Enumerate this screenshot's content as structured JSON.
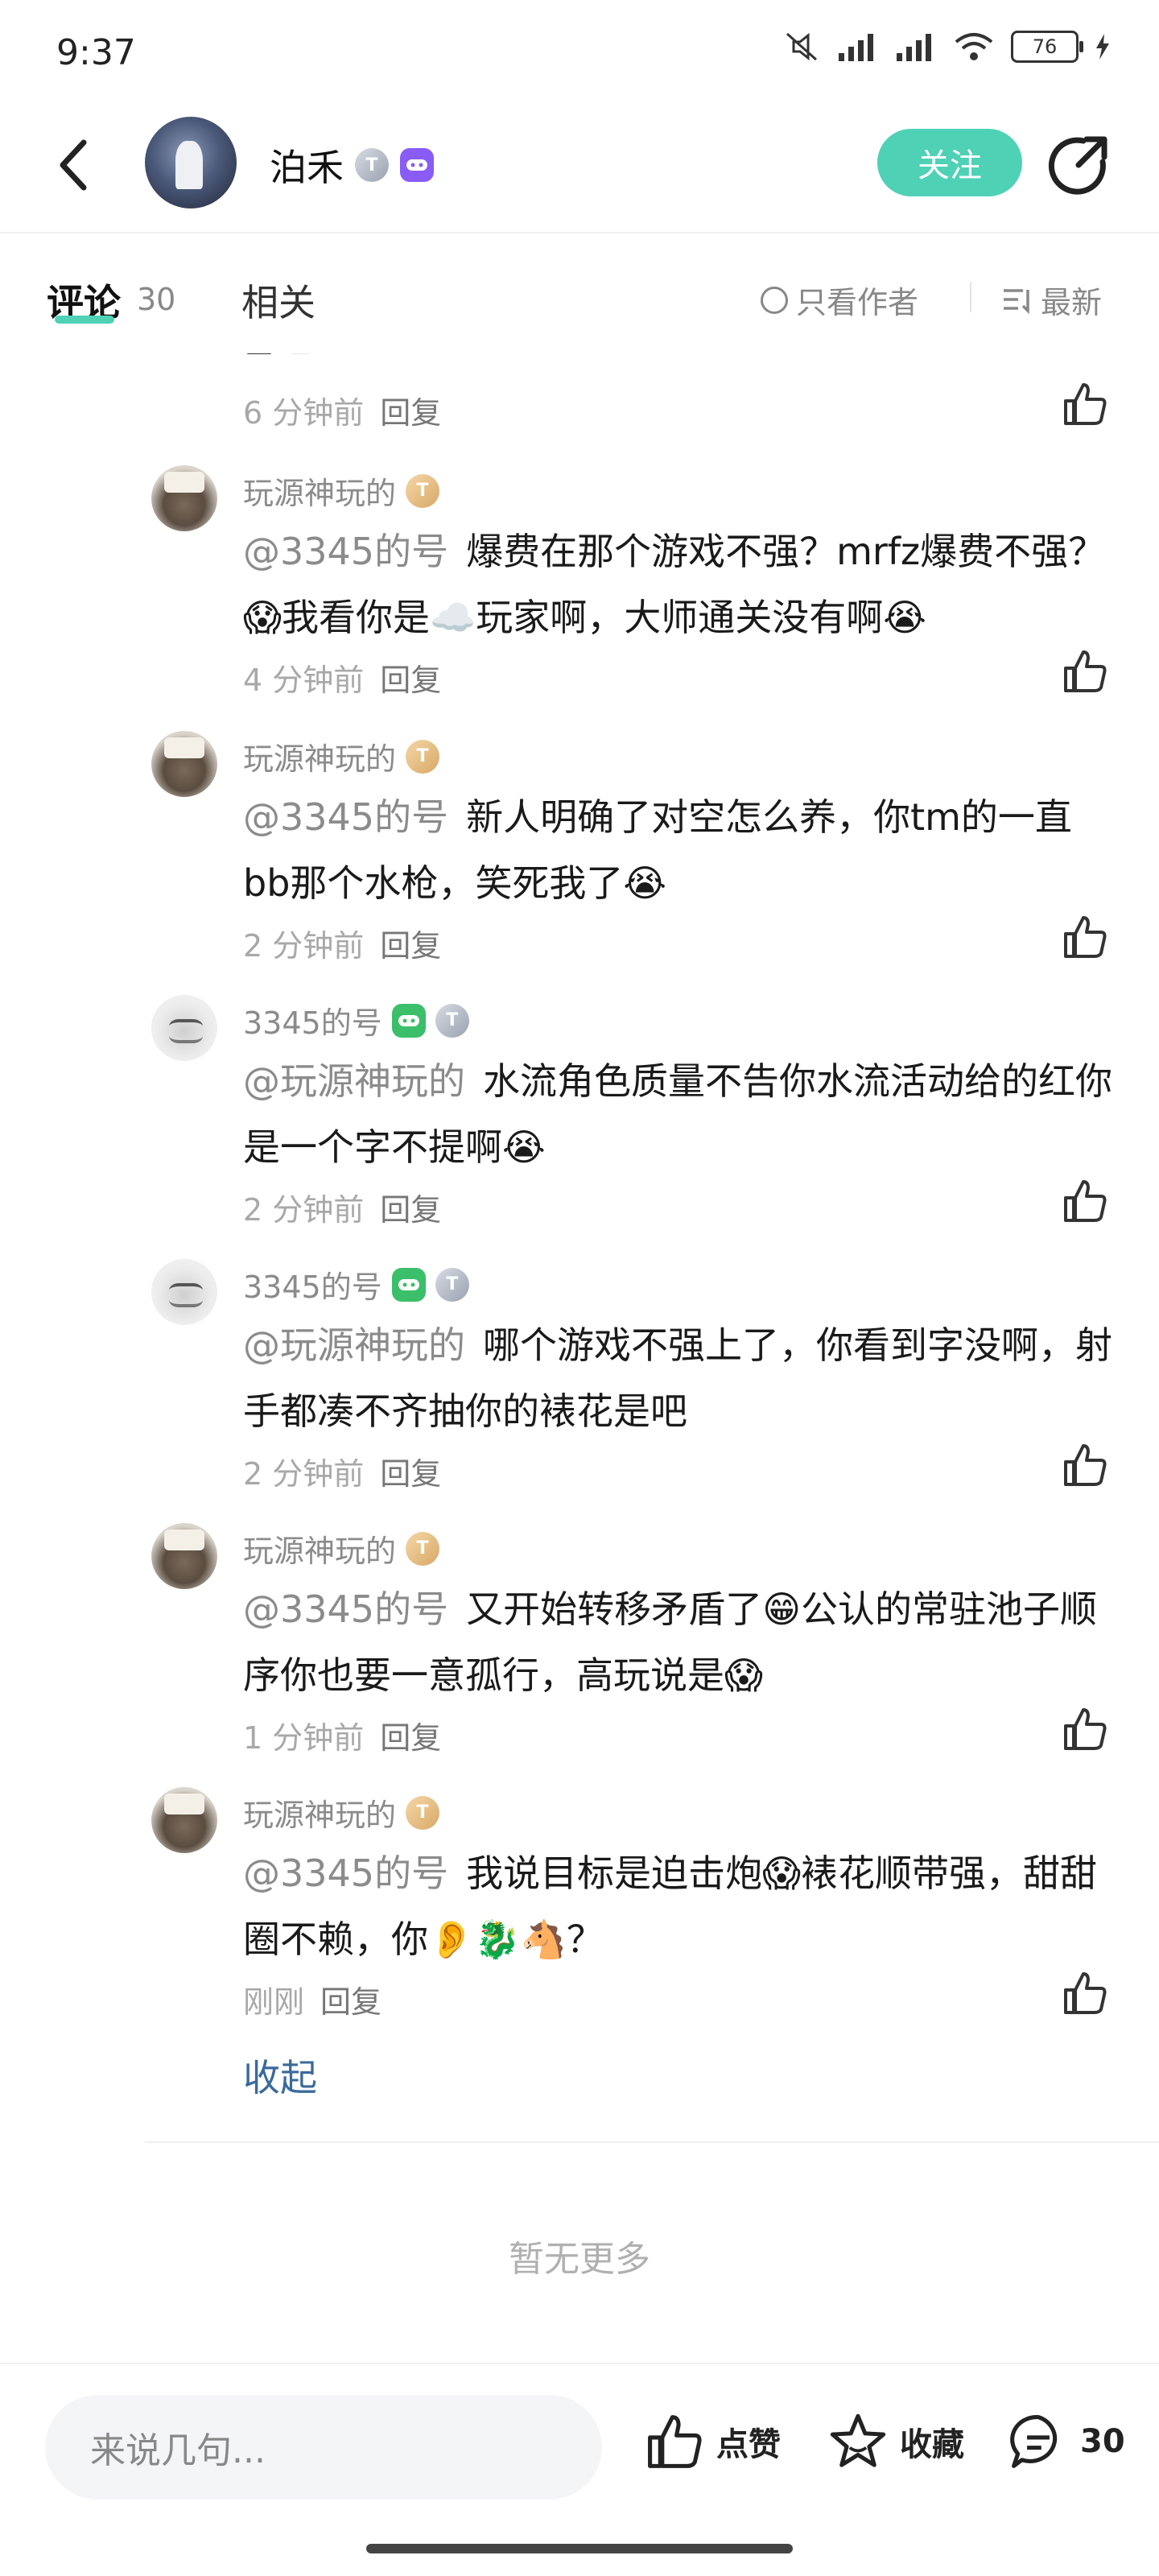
{
  "status_bar": {
    "time": "9:37",
    "battery": "76"
  },
  "header": {
    "username": "泊禾",
    "follow_label": "关注"
  },
  "tabs": {
    "comments_label": "评论",
    "comments_count": "30",
    "related_label": "相关",
    "only_author_label": "只看作者",
    "sort_label": "最新"
  },
  "partial_text": "是吧",
  "comments": [
    {
      "author": "",
      "time": "6 分钟前",
      "reply": "回复"
    },
    {
      "author": "玩源神玩的",
      "mention": "@3345的号",
      "text": "爆费在那个游戏不强？mrfz爆费不强？😱我看你是☁️玩家啊，大师通关没有啊😭",
      "time": "4 分钟前",
      "reply": "回复"
    },
    {
      "author": "玩源神玩的",
      "mention": "@3345的号",
      "text": "新人明确了对空怎么养，你tm的一直bb那个水枪，笑死我了😭",
      "time": "2 分钟前",
      "reply": "回复"
    },
    {
      "author": "3345的号",
      "mention": "@玩源神玩的",
      "text": "水流角色质量不告你水流活动给的红你是一个字不提啊😭",
      "time": "2 分钟前",
      "reply": "回复"
    },
    {
      "author": "3345的号",
      "mention": "@玩源神玩的",
      "text": "哪个游戏不强上了，你看到字没啊，射手都凑不齐抽你的裱花是吧",
      "time": "2 分钟前",
      "reply": "回复"
    },
    {
      "author": "玩源神玩的",
      "mention": "@3345的号",
      "text": "又开始转移矛盾了😁公认的常驻池子顺序你也要一意孤行，高玩说是😱",
      "time": "1 分钟前",
      "reply": "回复"
    },
    {
      "author": "玩源神玩的",
      "mention": "@3345的号",
      "text": "我说目标是迫击炮😱裱花顺带强，甜甜圈不赖，你👂🐉🐴？",
      "time": "刚刚",
      "reply": "回复"
    }
  ],
  "collapse_label": "收起",
  "no_more_label": "暂无更多",
  "bottom_bar": {
    "input_placeholder": "来说几句...",
    "like_label": "点赞",
    "favorite_label": "收藏",
    "comment_count": "30"
  },
  "colors": {
    "accent": "#4fd1b6",
    "link": "#3a6a9a",
    "muted": "#8b8b8b"
  }
}
